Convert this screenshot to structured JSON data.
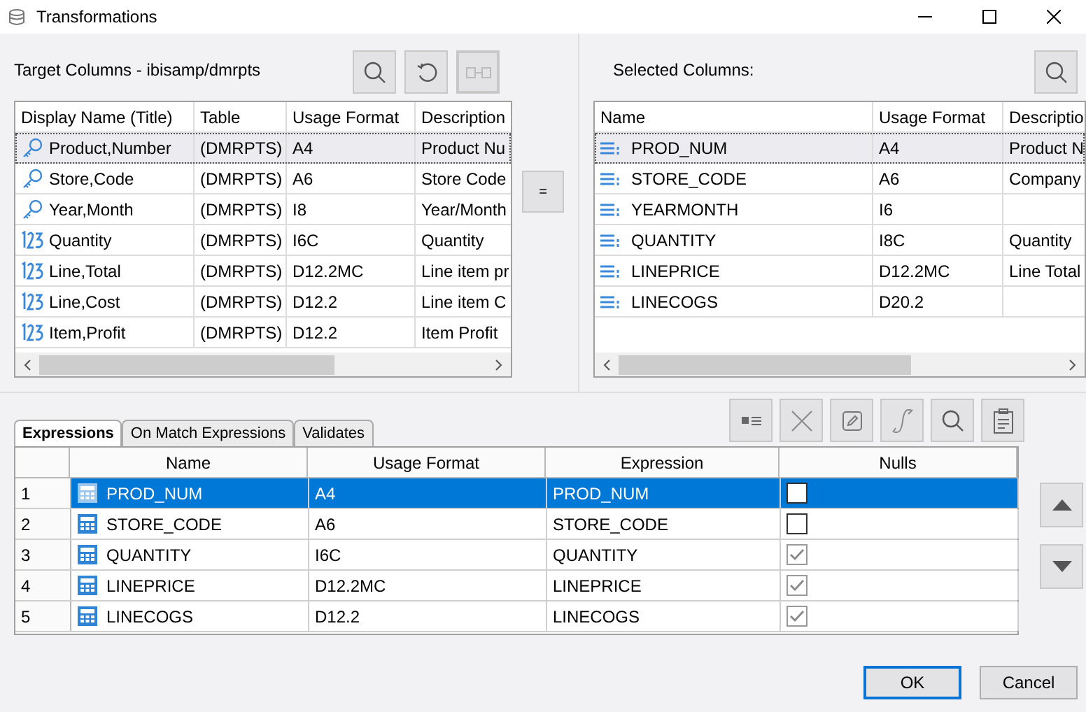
{
  "window": {
    "title": "Transformations"
  },
  "target": {
    "title": "Target Columns - ibisamp/dmrpts",
    "columns": [
      "Display Name (Title)",
      "Table",
      "Usage Format",
      "Description"
    ],
    "rows": [
      {
        "kind": "key",
        "name": "Product,Number",
        "table": "(DMRPTS)",
        "format": "A4",
        "description": "Product Nu",
        "selected": true
      },
      {
        "kind": "key",
        "name": "Store,Code",
        "table": "(DMRPTS)",
        "format": "A6",
        "description": "Store Code",
        "selected": false
      },
      {
        "kind": "key",
        "name": "Year,Month",
        "table": "(DMRPTS)",
        "format": "I8",
        "description": "Year/Month",
        "selected": false
      },
      {
        "kind": "number",
        "name": "Quantity",
        "table": "(DMRPTS)",
        "format": "I6C",
        "description": "Quantity",
        "selected": false
      },
      {
        "kind": "number",
        "name": "Line,Total",
        "table": "(DMRPTS)",
        "format": "D12.2MC",
        "description": "Line item pr",
        "selected": false
      },
      {
        "kind": "number",
        "name": "Line,Cost",
        "table": "(DMRPTS)",
        "format": "D12.2",
        "description": "Line item C",
        "selected": false
      },
      {
        "kind": "number",
        "name": "Item,Profit",
        "table": "(DMRPTS)",
        "format": "D12.2",
        "description": "Item Profit",
        "selected": false
      }
    ]
  },
  "equal_button": "=",
  "selected": {
    "title": "Selected Columns:",
    "columns": [
      "Name",
      "Usage Format",
      "Descriptio"
    ],
    "rows": [
      {
        "name": "PROD_NUM",
        "format": "A4",
        "description": "Product N",
        "selected": true
      },
      {
        "name": "STORE_CODE",
        "format": "A6",
        "description": "Company",
        "selected": false
      },
      {
        "name": "YEARMONTH",
        "format": "I6",
        "selected": false
      },
      {
        "name": "QUANTITY",
        "format": "I8C",
        "description": "Quantity",
        "selected": false
      },
      {
        "name": "LINEPRICE",
        "format": "D12.2MC",
        "description": "Line Total",
        "selected": false
      },
      {
        "name": "LINECOGS",
        "format": "D20.2",
        "selected": false
      }
    ]
  },
  "tabs": [
    {
      "label": "Expressions",
      "selected": true
    },
    {
      "label": "On Match Expressions",
      "selected": false
    },
    {
      "label": "Validates",
      "selected": false
    }
  ],
  "grid": {
    "columns": [
      "Name",
      "Usage Format",
      "Expression",
      "Nulls"
    ],
    "rows": [
      {
        "number": "1",
        "name": "PROD_NUM",
        "format": "A4",
        "expression": "PROD_NUM",
        "checked": false,
        "selected": true
      },
      {
        "number": "2",
        "name": "STORE_CODE",
        "format": "A6",
        "expression": "STORE_CODE",
        "checked": false,
        "selected": false
      },
      {
        "number": "3",
        "name": "QUANTITY",
        "format": "I6C",
        "expression": "QUANTITY",
        "checked": true,
        "selected": false
      },
      {
        "number": "4",
        "name": "LINEPRICE",
        "format": "D12.2MC",
        "expression": "LINEPRICE",
        "checked": true,
        "selected": false
      },
      {
        "number": "5",
        "name": "LINECOGS",
        "format": "D12.2",
        "expression": "LINECOGS",
        "checked": true,
        "selected": false
      }
    ]
  },
  "buttons": [
    {
      "label": "OK",
      "kind": "default"
    },
    {
      "label": "Cancel",
      "kind": "normal"
    }
  ]
}
